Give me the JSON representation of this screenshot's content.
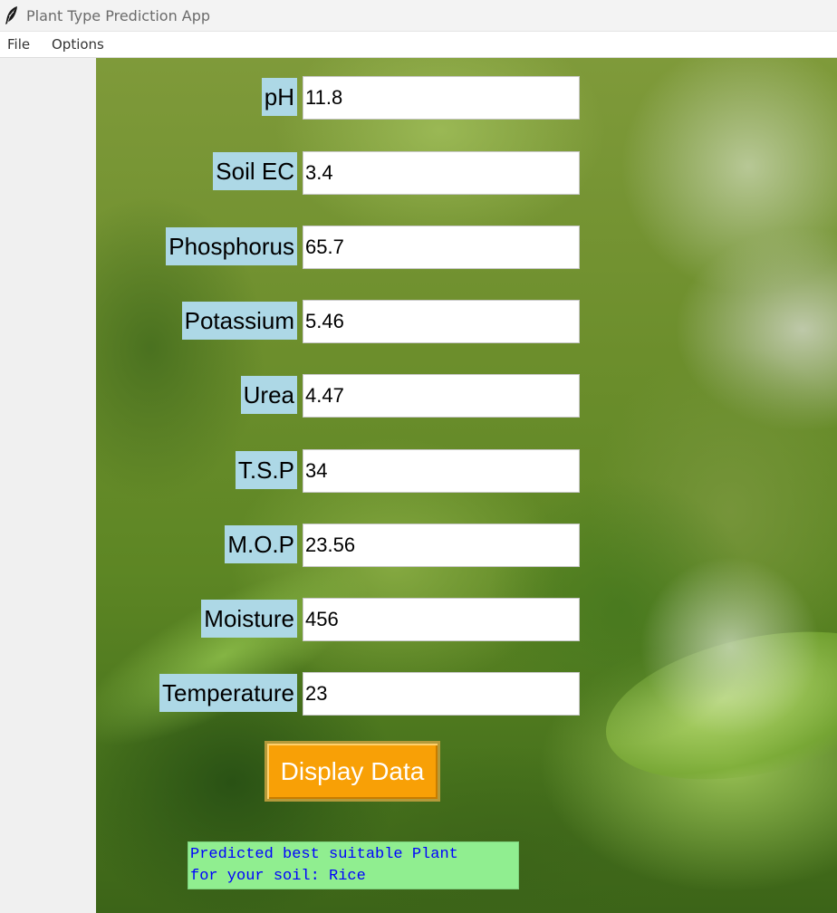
{
  "window": {
    "title": "Plant Type Prediction App",
    "icon": "feather-icon"
  },
  "menu": {
    "items": [
      "File",
      "Options"
    ]
  },
  "form": {
    "fields": [
      {
        "label": "pH",
        "value": "11.8"
      },
      {
        "label": "Soil EC",
        "value": "3.4"
      },
      {
        "label": "Phosphorus",
        "value": "65.7"
      },
      {
        "label": "Potassium",
        "value": "5.46"
      },
      {
        "label": "Urea",
        "value": "4.47"
      },
      {
        "label": "T.S.P",
        "value": "34"
      },
      {
        "label": "M.O.P",
        "value": "23.56"
      },
      {
        "label": "Moisture",
        "value": "456"
      },
      {
        "label": "Temperature",
        "value": "23"
      }
    ],
    "button_label": "Display Data",
    "result_text": "Predicted best suitable Plant\nfor your soil: Rice"
  },
  "colors": {
    "label_bg": "#add8e6",
    "button_bg": "#f8a006",
    "result_bg": "#90ee90",
    "result_text": "#0000ff"
  }
}
